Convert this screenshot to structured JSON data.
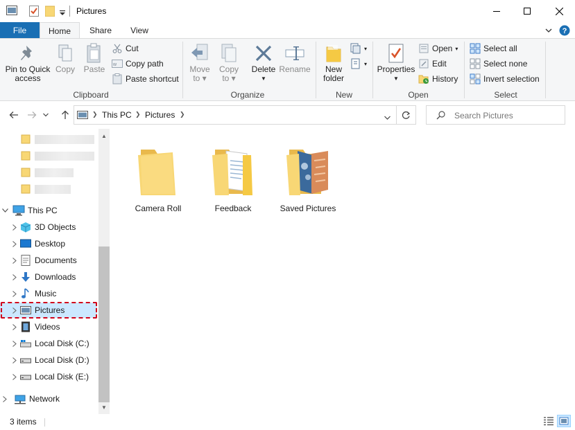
{
  "window": {
    "title": "Pictures"
  },
  "tabs": {
    "file": "File",
    "home": "Home",
    "share": "Share",
    "view": "View"
  },
  "ribbon": {
    "clipboard": {
      "label": "Clipboard",
      "pin_line1": "Pin to Quick",
      "pin_line2": "access",
      "copy": "Copy",
      "paste": "Paste",
      "cut": "Cut",
      "copy_path": "Copy path",
      "paste_shortcut": "Paste shortcut"
    },
    "organize": {
      "label": "Organize",
      "move_to_line1": "Move",
      "move_to_line2": "to",
      "copy_to_line1": "Copy",
      "copy_to_line2": "to",
      "delete": "Delete",
      "rename": "Rename"
    },
    "new": {
      "label": "New",
      "new_folder_line1": "New",
      "new_folder_line2": "folder"
    },
    "open": {
      "label": "Open",
      "properties": "Properties",
      "open": "Open",
      "edit": "Edit",
      "history": "History"
    },
    "select": {
      "label": "Select",
      "select_all": "Select all",
      "select_none": "Select none",
      "invert": "Invert selection"
    }
  },
  "address": {
    "crumbs": [
      "This PC",
      "Pictures"
    ],
    "search_placeholder": "Search Pictures"
  },
  "nav": {
    "this_pc": "This PC",
    "items": [
      {
        "label": "3D Objects",
        "icon": "3d-objects-icon"
      },
      {
        "label": "Desktop",
        "icon": "desktop-icon"
      },
      {
        "label": "Documents",
        "icon": "documents-icon"
      },
      {
        "label": "Downloads",
        "icon": "downloads-icon"
      },
      {
        "label": "Music",
        "icon": "music-icon"
      },
      {
        "label": "Pictures",
        "icon": "pictures-icon"
      },
      {
        "label": "Videos",
        "icon": "videos-icon"
      },
      {
        "label": "Local Disk (C:)",
        "icon": "drive-c-icon"
      },
      {
        "label": "Local Disk (D:)",
        "icon": "drive-icon"
      },
      {
        "label": "Local Disk (E:)",
        "icon": "drive-icon"
      }
    ],
    "network": "Network",
    "selected": "Pictures"
  },
  "content": {
    "folders": [
      {
        "label": "Camera Roll"
      },
      {
        "label": "Feedback"
      },
      {
        "label": "Saved Pictures"
      }
    ]
  },
  "status": {
    "item_count": "3 items"
  },
  "colors": {
    "accent": "#1a6fb4",
    "selection": "#cce8ff",
    "highlight_outline": "#d0021b",
    "folder": "#f8d775"
  }
}
